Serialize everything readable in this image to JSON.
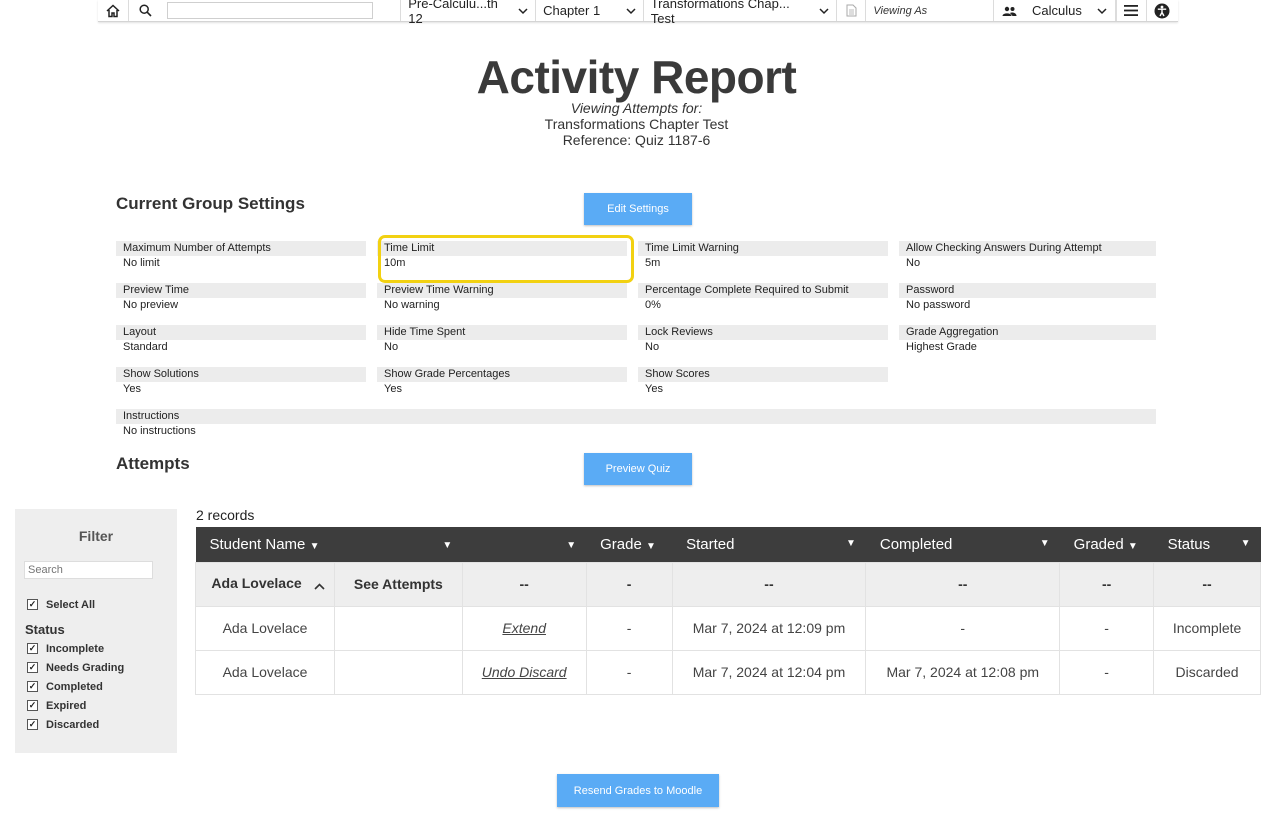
{
  "nav": {
    "course": "Pre-Calculu...th 12",
    "chapter": "Chapter 1",
    "activity": "Transformations Chap... Test",
    "viewing_as": "Viewing As",
    "group": "Calculus"
  },
  "header": {
    "title": "Activity Report",
    "viewing_label": "Viewing Attempts for:",
    "activity_name": "Transformations Chapter Test",
    "reference": "Reference: Quiz 1187-6"
  },
  "settings_section": {
    "title": "Current Group Settings",
    "edit_button": "Edit Settings",
    "items": [
      {
        "label": "Maximum Number of Attempts",
        "value": "No limit"
      },
      {
        "label": "Time Limit",
        "value": "10m"
      },
      {
        "label": "Time Limit Warning",
        "value": "5m"
      },
      {
        "label": "Allow Checking Answers During Attempt",
        "value": "No"
      },
      {
        "label": "Preview Time",
        "value": "No preview"
      },
      {
        "label": "Preview Time Warning",
        "value": "No warning"
      },
      {
        "label": "Percentage Complete Required to Submit",
        "value": "0%"
      },
      {
        "label": "Password",
        "value": "No password"
      },
      {
        "label": "Layout",
        "value": "Standard"
      },
      {
        "label": "Hide Time Spent",
        "value": "No"
      },
      {
        "label": "Lock Reviews",
        "value": "No"
      },
      {
        "label": "Grade Aggregation",
        "value": "Highest Grade"
      },
      {
        "label": "Show Solutions",
        "value": "Yes"
      },
      {
        "label": "Show Grade Percentages",
        "value": "Yes"
      },
      {
        "label": "Show Scores",
        "value": "Yes"
      },
      {
        "label": "Instructions",
        "value": "No instructions"
      }
    ]
  },
  "attempts_section": {
    "title": "Attempts",
    "preview_button": "Preview Quiz",
    "records": "2 records"
  },
  "filter": {
    "title": "Filter",
    "search_placeholder": "Search",
    "select_all": "Select All",
    "status_title": "Status",
    "statuses": [
      "Incomplete",
      "Needs Grading",
      "Completed",
      "Expired",
      "Discarded"
    ]
  },
  "table": {
    "headers": [
      "Student Name",
      "",
      "",
      "Grade",
      "Started",
      "Completed",
      "Graded",
      "Status"
    ],
    "group_row": {
      "student": "Ada Lovelace",
      "action": "See Attempts",
      "c3": "--",
      "grade": "-",
      "started": "--",
      "completed": "--",
      "graded": "--",
      "status": "--"
    },
    "rows": [
      {
        "student": "Ada Lovelace",
        "action": "Extend",
        "grade": "-",
        "started": "Mar 7, 2024 at 12:09 pm",
        "completed": "-",
        "graded": "-",
        "status": "Incomplete"
      },
      {
        "student": "Ada Lovelace",
        "action": "Undo Discard",
        "grade": "-",
        "started": "Mar 7, 2024 at 12:04 pm",
        "completed": "Mar 7, 2024 at 12:08 pm",
        "graded": "-",
        "status": "Discarded"
      }
    ]
  },
  "footer": {
    "resend_button": "Resend Grades to Moodle"
  },
  "colors": {
    "accent_button": "#5aabf5",
    "table_header": "#3d3d3d",
    "highlight": "#f2d111"
  }
}
